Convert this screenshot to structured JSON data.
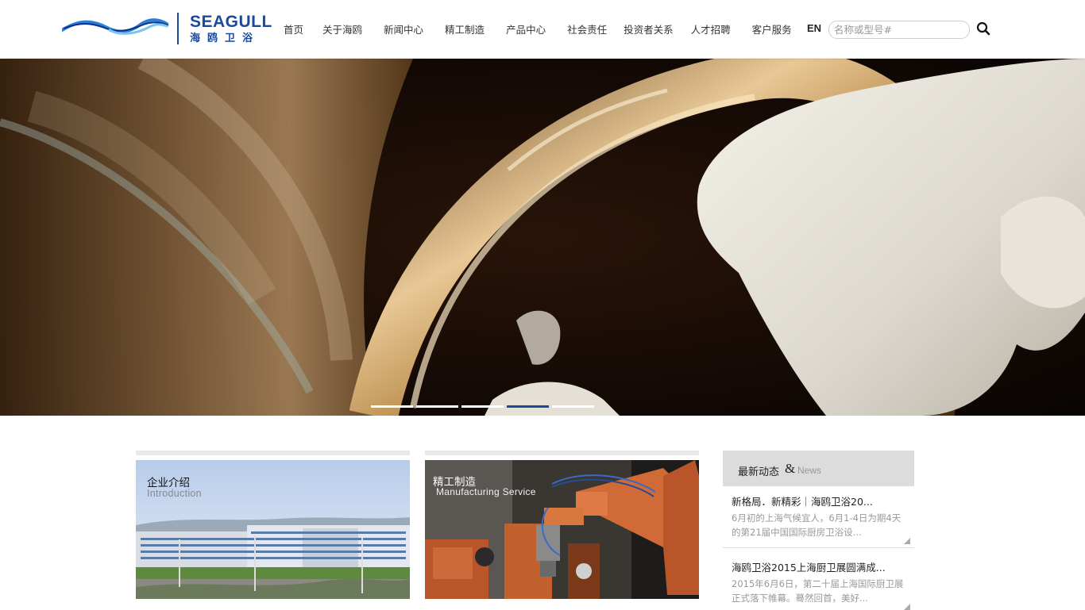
{
  "brand": {
    "name_en": "SEAGULL",
    "name_cn": "海鸥卫浴"
  },
  "nav": {
    "items": [
      "首页",
      "关于海鸥",
      "新闻中心",
      "精工制造",
      "产品中心",
      "社会责任",
      "投资者关系",
      "人才招聘",
      "客户服务"
    ]
  },
  "header": {
    "lang": "EN",
    "search_placeholder": "名称或型号#"
  },
  "banner": {
    "active_slide": 4,
    "slide_count": 5
  },
  "cards": [
    {
      "title": "企业介绍",
      "subtitle": "Introduction"
    },
    {
      "title": "精工制造",
      "subtitle": "Manufacturing Service"
    }
  ],
  "news": {
    "title": "最新动态",
    "amp": "&",
    "title_en": "News",
    "items": [
      {
        "headline": "新格局．新精彩｜海鸥卫浴20...",
        "desc": "6月初的上海气候宜人，6月1-4日为期4天的第21届中国国际厨房卫浴设..."
      },
      {
        "headline": "海鸥卫浴2015上海厨卫展圆满成...",
        "desc": "2015年6月6日，第二十届上海国际厨卫展正式落下帷幕。蓦然回首，美好..."
      }
    ]
  },
  "colors": {
    "brand_blue": "#1a4a9c",
    "nav_text": "#333333",
    "muted_text": "#999999"
  }
}
